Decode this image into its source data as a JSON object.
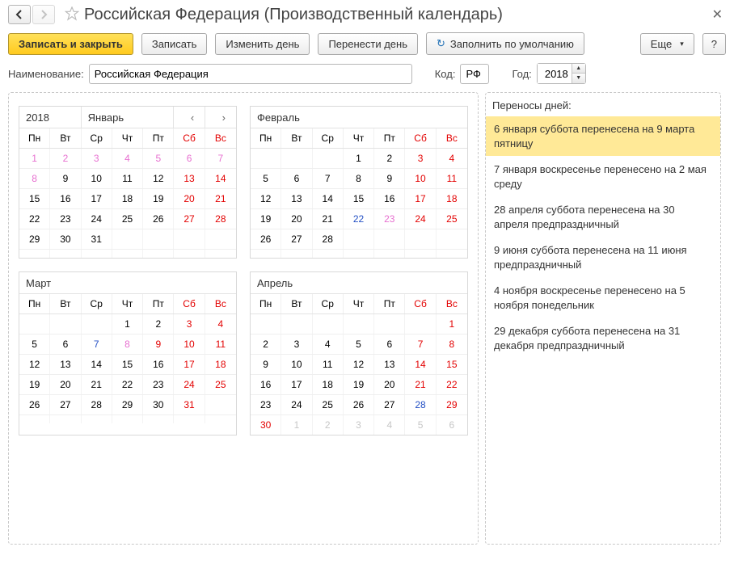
{
  "title": "Российская Федерация (Производственный календарь)",
  "toolbar": {
    "save_close": "Записать и закрыть",
    "save": "Записать",
    "change_day": "Изменить день",
    "move_day": "Перенести день",
    "fill_default": "Заполнить по умолчанию",
    "more": "Еще",
    "help": "?"
  },
  "form": {
    "name_label": "Наименование:",
    "name_value": "Российская Федерация",
    "code_label": "Код:",
    "code_value": "РФ",
    "year_label": "Год:",
    "year_value": "2018"
  },
  "first_month_year": "2018",
  "dow": [
    "Пн",
    "Вт",
    "Ср",
    "Чт",
    "Пт",
    "Сб",
    "Вс"
  ],
  "months": [
    {
      "name": "Январь",
      "show_year": true,
      "show_arrows": true,
      "weeks": [
        [
          {
            "n": "1",
            "c": "hol"
          },
          {
            "n": "2",
            "c": "hol"
          },
          {
            "n": "3",
            "c": "hol"
          },
          {
            "n": "4",
            "c": "hol"
          },
          {
            "n": "5",
            "c": "hol"
          },
          {
            "n": "6",
            "c": "hol"
          },
          {
            "n": "7",
            "c": "hol"
          }
        ],
        [
          {
            "n": "8",
            "c": "hol"
          },
          {
            "n": "9"
          },
          {
            "n": "10"
          },
          {
            "n": "11"
          },
          {
            "n": "12"
          },
          {
            "n": "13",
            "c": "we"
          },
          {
            "n": "14",
            "c": "we"
          }
        ],
        [
          {
            "n": "15"
          },
          {
            "n": "16"
          },
          {
            "n": "17"
          },
          {
            "n": "18"
          },
          {
            "n": "19"
          },
          {
            "n": "20",
            "c": "we"
          },
          {
            "n": "21",
            "c": "we"
          }
        ],
        [
          {
            "n": "22"
          },
          {
            "n": "23"
          },
          {
            "n": "24"
          },
          {
            "n": "25"
          },
          {
            "n": "26"
          },
          {
            "n": "27",
            "c": "we"
          },
          {
            "n": "28",
            "c": "we"
          }
        ],
        [
          {
            "n": "29"
          },
          {
            "n": "30"
          },
          {
            "n": "31"
          },
          {
            "n": ""
          },
          {
            "n": ""
          },
          {
            "n": ""
          },
          {
            "n": ""
          }
        ],
        [
          {
            "n": ""
          },
          {
            "n": ""
          },
          {
            "n": ""
          },
          {
            "n": ""
          },
          {
            "n": ""
          },
          {
            "n": ""
          },
          {
            "n": ""
          }
        ]
      ]
    },
    {
      "name": "Февраль",
      "weeks": [
        [
          {
            "n": ""
          },
          {
            "n": ""
          },
          {
            "n": ""
          },
          {
            "n": "1"
          },
          {
            "n": "2"
          },
          {
            "n": "3",
            "c": "we"
          },
          {
            "n": "4",
            "c": "we"
          }
        ],
        [
          {
            "n": "5"
          },
          {
            "n": "6"
          },
          {
            "n": "7"
          },
          {
            "n": "8"
          },
          {
            "n": "9"
          },
          {
            "n": "10",
            "c": "we"
          },
          {
            "n": "11",
            "c": "we"
          }
        ],
        [
          {
            "n": "12"
          },
          {
            "n": "13"
          },
          {
            "n": "14"
          },
          {
            "n": "15"
          },
          {
            "n": "16"
          },
          {
            "n": "17",
            "c": "we"
          },
          {
            "n": "18",
            "c": "we"
          }
        ],
        [
          {
            "n": "19"
          },
          {
            "n": "20"
          },
          {
            "n": "21"
          },
          {
            "n": "22",
            "c": "short"
          },
          {
            "n": "23",
            "c": "hol"
          },
          {
            "n": "24",
            "c": "we"
          },
          {
            "n": "25",
            "c": "we"
          }
        ],
        [
          {
            "n": "26"
          },
          {
            "n": "27"
          },
          {
            "n": "28"
          },
          {
            "n": ""
          },
          {
            "n": ""
          },
          {
            "n": ""
          },
          {
            "n": ""
          }
        ],
        [
          {
            "n": ""
          },
          {
            "n": ""
          },
          {
            "n": ""
          },
          {
            "n": ""
          },
          {
            "n": ""
          },
          {
            "n": ""
          },
          {
            "n": ""
          }
        ]
      ]
    },
    {
      "name": "Март",
      "weeks": [
        [
          {
            "n": ""
          },
          {
            "n": ""
          },
          {
            "n": ""
          },
          {
            "n": "1"
          },
          {
            "n": "2"
          },
          {
            "n": "3",
            "c": "we"
          },
          {
            "n": "4",
            "c": "we"
          }
        ],
        [
          {
            "n": "5"
          },
          {
            "n": "6"
          },
          {
            "n": "7",
            "c": "short"
          },
          {
            "n": "8",
            "c": "hol"
          },
          {
            "n": "9",
            "c": "we"
          },
          {
            "n": "10",
            "c": "we"
          },
          {
            "n": "11",
            "c": "we"
          }
        ],
        [
          {
            "n": "12"
          },
          {
            "n": "13"
          },
          {
            "n": "14"
          },
          {
            "n": "15"
          },
          {
            "n": "16"
          },
          {
            "n": "17",
            "c": "we"
          },
          {
            "n": "18",
            "c": "we"
          }
        ],
        [
          {
            "n": "19"
          },
          {
            "n": "20"
          },
          {
            "n": "21"
          },
          {
            "n": "22"
          },
          {
            "n": "23"
          },
          {
            "n": "24",
            "c": "we"
          },
          {
            "n": "25",
            "c": "we"
          }
        ],
        [
          {
            "n": "26"
          },
          {
            "n": "27"
          },
          {
            "n": "28"
          },
          {
            "n": "29"
          },
          {
            "n": "30"
          },
          {
            "n": "31",
            "c": "we"
          },
          {
            "n": ""
          }
        ],
        [
          {
            "n": ""
          },
          {
            "n": ""
          },
          {
            "n": ""
          },
          {
            "n": ""
          },
          {
            "n": ""
          },
          {
            "n": ""
          },
          {
            "n": ""
          }
        ]
      ]
    },
    {
      "name": "Апрель",
      "weeks": [
        [
          {
            "n": ""
          },
          {
            "n": ""
          },
          {
            "n": ""
          },
          {
            "n": ""
          },
          {
            "n": ""
          },
          {
            "n": ""
          },
          {
            "n": "1",
            "c": "we"
          }
        ],
        [
          {
            "n": "2"
          },
          {
            "n": "3"
          },
          {
            "n": "4"
          },
          {
            "n": "5"
          },
          {
            "n": "6"
          },
          {
            "n": "7",
            "c": "we"
          },
          {
            "n": "8",
            "c": "we"
          }
        ],
        [
          {
            "n": "9"
          },
          {
            "n": "10"
          },
          {
            "n": "11"
          },
          {
            "n": "12"
          },
          {
            "n": "13"
          },
          {
            "n": "14",
            "c": "we"
          },
          {
            "n": "15",
            "c": "we"
          }
        ],
        [
          {
            "n": "16"
          },
          {
            "n": "17"
          },
          {
            "n": "18"
          },
          {
            "n": "19"
          },
          {
            "n": "20"
          },
          {
            "n": "21",
            "c": "we"
          },
          {
            "n": "22",
            "c": "we"
          }
        ],
        [
          {
            "n": "23"
          },
          {
            "n": "24"
          },
          {
            "n": "25"
          },
          {
            "n": "26"
          },
          {
            "n": "27"
          },
          {
            "n": "28",
            "c": "short"
          },
          {
            "n": "29",
            "c": "we"
          }
        ],
        [
          {
            "n": "30",
            "c": "we"
          },
          {
            "n": "1",
            "c": "grey"
          },
          {
            "n": "2",
            "c": "grey"
          },
          {
            "n": "3",
            "c": "grey"
          },
          {
            "n": "4",
            "c": "grey"
          },
          {
            "n": "5",
            "c": "grey"
          },
          {
            "n": "6",
            "c": "grey"
          }
        ]
      ]
    }
  ],
  "side": {
    "title": "Переносы дней:",
    "items": [
      "6 января суббота перенесена на 9 марта пятницу",
      "7 января воскресенье перенесено на 2 мая среду",
      "28 апреля суббота перенесена на 30 апреля предпраздничный",
      "9 июня суббота перенесена на 11 июня предпраздничный",
      "4 ноября воскресенье перенесено на 5 ноября понедельник",
      "29 декабря суббота перенесена на 31 декабря предпраздничный"
    ]
  }
}
